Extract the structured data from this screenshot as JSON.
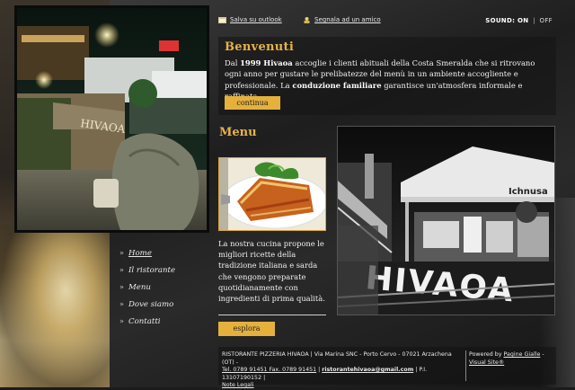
{
  "topbar": {
    "save_outlook": "Salva su outlook",
    "tell_friend": "Segnala ad un amico",
    "sound_label": "SOUND:",
    "sound_on": "ON",
    "sound_sep": "|",
    "sound_off": "OFF"
  },
  "welcome": {
    "title": "Benvenuti",
    "p_dal": "Dal ",
    "p_bold1": "1999 Hivaoa",
    "p_mid": " accoglie i clienti abituali della Costa Smeralda che si ritrovano ogni anno per gustare le prelibatezze del menù in un ambiente accogliente e professionale. La ",
    "p_bold2": "conduzione familiare",
    "p_end": " garantisce un'atmosfera informale e raffinata.",
    "button": "continua"
  },
  "menu_section": {
    "title": "Menu",
    "text": "La nostra cucina propone le migliori ricette della tradizione italiana e sarda che vengono preparate quotidianamente con ingredienti di prima qualità.",
    "button": "esplora"
  },
  "nav": {
    "bullet": "»",
    "items": [
      {
        "label": "Home"
      },
      {
        "label": "Il ristorante"
      },
      {
        "label": "Menu"
      },
      {
        "label": "Dove siamo"
      },
      {
        "label": "Contatti"
      }
    ]
  },
  "photo_sign": "HIVAOA",
  "hero_sign": "HIVAOA",
  "umbrella_brand": "Ichnusa",
  "footer": {
    "address": "RISTORANTE PIZZERIA HIVAOA | Via Marina SNC - Porto Cervo - 07021 Arzachena (OT) -",
    "phone": "Tel. 0789 91451 Fax. 0789 91451",
    "pipe1": " | ",
    "email": "ristorantehivaoa@gmail.com",
    "piva": " | P.I. 13107190152 |",
    "legal": "Note Legali",
    "powered": "Powered by ",
    "pg_link": "Pagine Gialle",
    "dash": " - ",
    "visual": "Visual Site®"
  },
  "colors": {
    "accent": "#e7b24a",
    "button": "#e5b13c",
    "text": "#f1f1f1",
    "background": "#1b1b1b"
  }
}
